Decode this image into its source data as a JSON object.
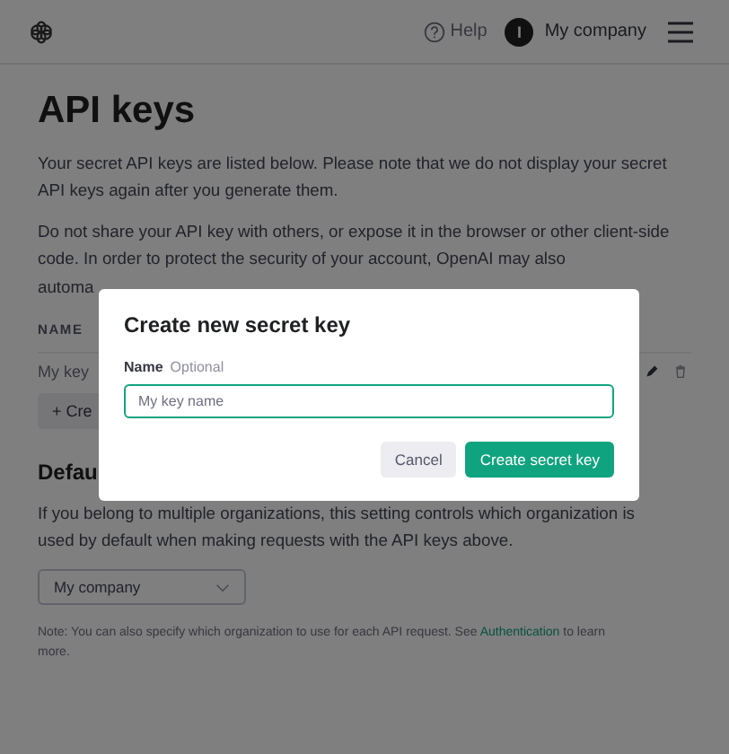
{
  "header": {
    "help": "Help",
    "avatar_initial": "I",
    "organization": "My company"
  },
  "page": {
    "title": "API keys",
    "intro_lines": [
      "Your secret API keys are listed below. Please note that we do not display your secret",
      "API keys again after you generate them."
    ],
    "warning_lines": [
      "Do not share your API key with others, or expose it in the browser or other client-side",
      "code. In order to protect the security of your account, OpenAI may also"
    ],
    "warning_cut": "automa",
    "keys_table": {
      "column": "NAME",
      "rows": [
        {
          "name": "My key"
        }
      ]
    },
    "create_button": "+ Cre",
    "default_org": {
      "heading": "Defau",
      "description_lines": [
        "If you belong to multiple organizations, this setting controls which organization is",
        "used by default when making requests with the API keys above."
      ],
      "select_value": "My company",
      "note_before": "Note: You can also specify which organization to use for each API request. See",
      "note_link": "Authentication",
      "note_after": "to learn more."
    }
  },
  "dialog": {
    "title": "Create new secret key",
    "field_label": "Name",
    "field_hint": "Optional",
    "placeholder": "My key name",
    "buttons": [
      {
        "label": "Cancel",
        "kind": "secondary"
      },
      {
        "label": "Create secret key",
        "kind": "primary"
      }
    ]
  }
}
